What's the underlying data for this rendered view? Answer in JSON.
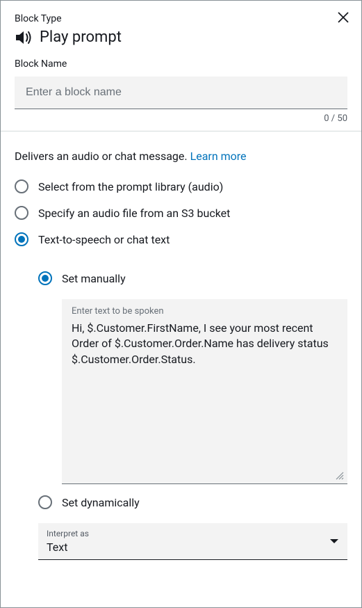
{
  "header": {
    "block_type_label": "Block Type",
    "title": "Play prompt",
    "block_name_label": "Block Name",
    "block_name_placeholder": "Enter a block name",
    "block_name_value": "",
    "counter": "0 / 50"
  },
  "body": {
    "description_text": "Delivers an audio or chat message. ",
    "learn_more_label": "Learn more",
    "options": [
      {
        "label": "Select from the prompt library (audio)",
        "selected": false
      },
      {
        "label": "Specify an audio file from an S3 bucket",
        "selected": false
      },
      {
        "label": "Text-to-speech or chat text",
        "selected": true
      }
    ],
    "tts": {
      "set_manually_label": "Set manually",
      "set_dynamically_label": "Set dynamically",
      "textarea_placeholder": "Enter text to be spoken",
      "textarea_value": "Hi, $.Customer.FirstName, I see your most recent Order of $.Customer.Order.Name has delivery status $.Customer.Order.Status.",
      "interpret_as_label": "Interpret as",
      "interpret_as_value": "Text"
    }
  }
}
